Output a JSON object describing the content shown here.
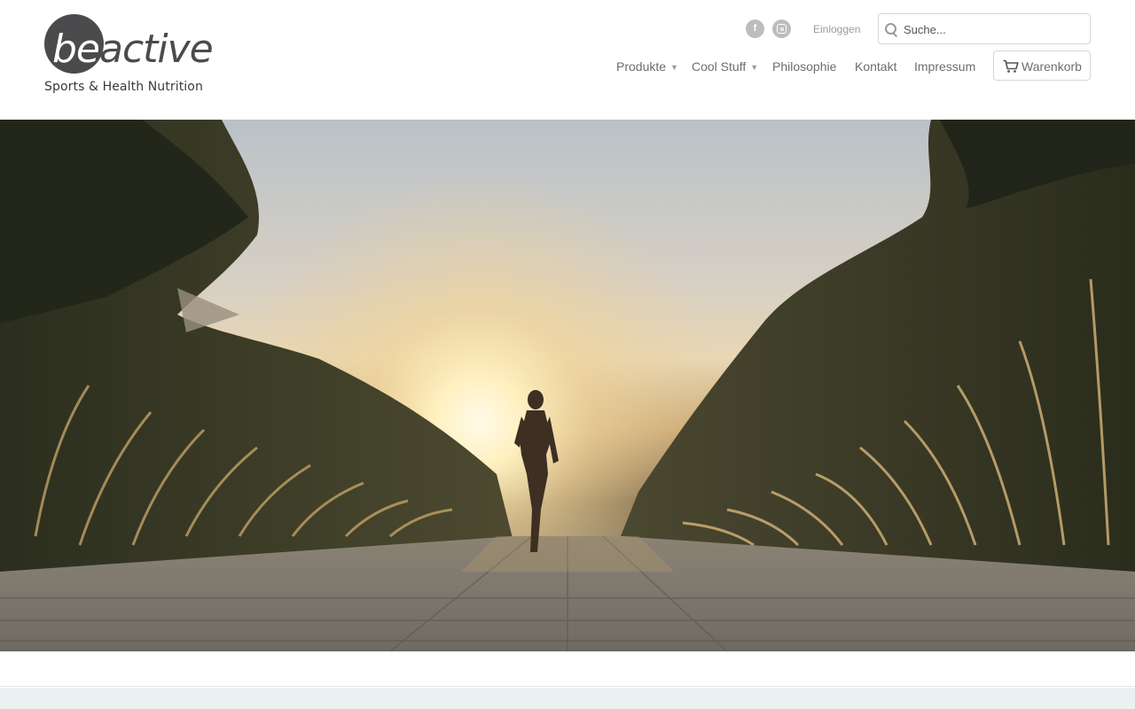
{
  "brand": {
    "logo_be": "be",
    "logo_active": "active",
    "tagline": "Sports & Health Nutrition",
    "dark_color": "#4b4b4d"
  },
  "header": {
    "social": [
      {
        "name": "facebook-icon",
        "glyph": "f"
      },
      {
        "name": "instagram-icon",
        "glyph": ""
      }
    ],
    "login_label": "Einloggen",
    "search": {
      "placeholder": "Suche...",
      "value": ""
    },
    "nav": [
      {
        "label": "Produkte",
        "has_dropdown": true
      },
      {
        "label": "Cool Stuff",
        "has_dropdown": true
      },
      {
        "label": "Philosophie",
        "has_dropdown": false
      },
      {
        "label": "Kontakt",
        "has_dropdown": false
      },
      {
        "label": "Impressum",
        "has_dropdown": false
      }
    ],
    "dropdown_caret": "▼",
    "cart_label": "Warenkorb"
  },
  "hero": {
    "image_alt": "",
    "sun_color": "#fff3d0",
    "sky_color": "#c4cacd"
  },
  "colors": {
    "footer_band": "#eaf1f1",
    "nav_text": "#6d6d6d",
    "icon_gray": "#bdbdbd"
  }
}
